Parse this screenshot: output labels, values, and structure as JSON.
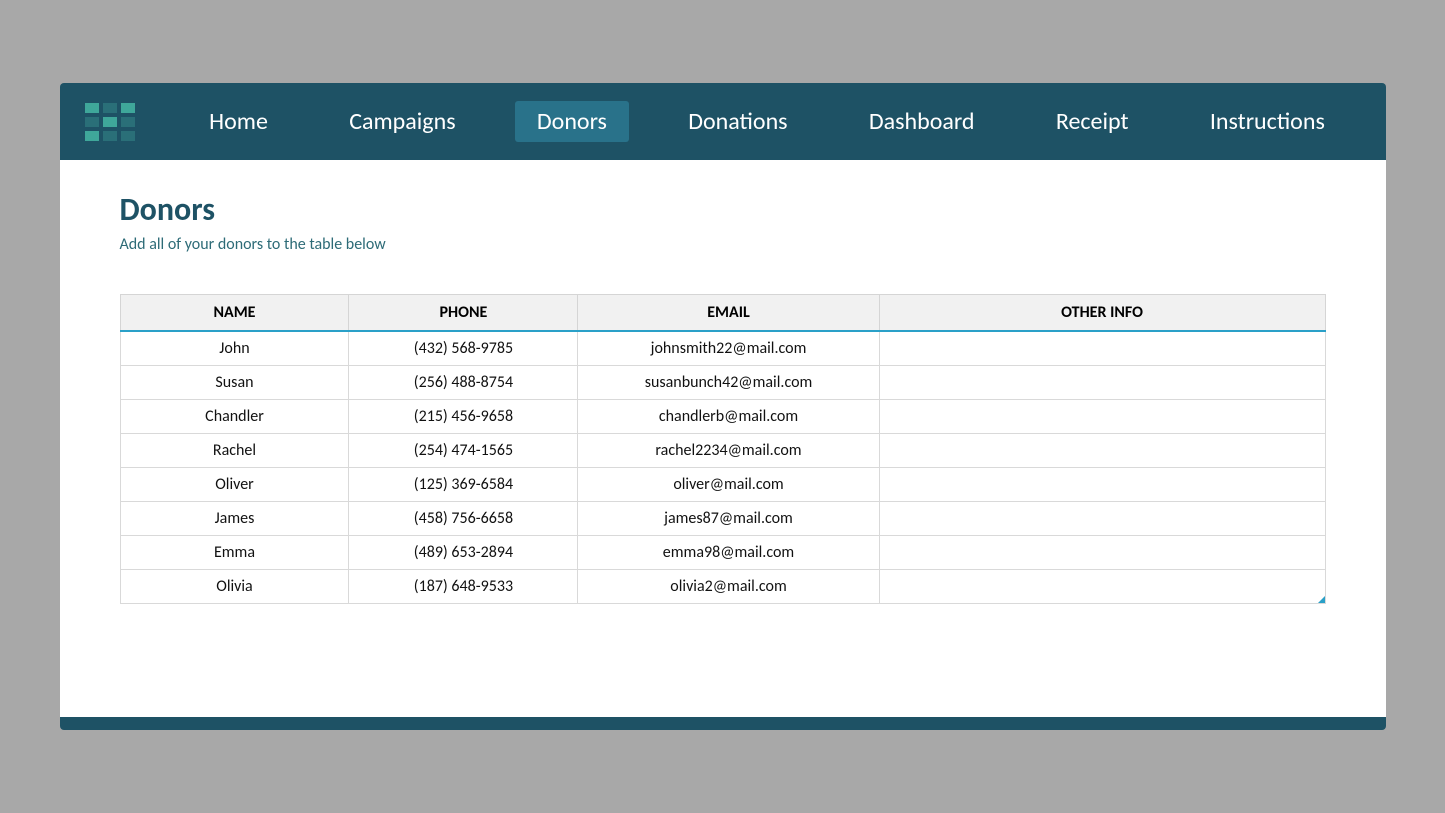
{
  "nav": {
    "items": [
      {
        "label": "Home",
        "id": "home",
        "active": false
      },
      {
        "label": "Campaigns",
        "id": "campaigns",
        "active": false
      },
      {
        "label": "Donors",
        "id": "donors",
        "active": true
      },
      {
        "label": "Donations",
        "id": "donations",
        "active": false
      },
      {
        "label": "Dashboard",
        "id": "dashboard",
        "active": false
      },
      {
        "label": "Receipt",
        "id": "receipt",
        "active": false
      },
      {
        "label": "Instructions",
        "id": "instructions",
        "active": false
      }
    ]
  },
  "page": {
    "title": "Donors",
    "subtitle": "Add all of your donors to the table below"
  },
  "table": {
    "columns": [
      "NAME",
      "PHONE",
      "EMAIL",
      "OTHER INFO"
    ],
    "rows": [
      {
        "name": "John",
        "phone": "(432) 568-9785",
        "email": "johnsmith22@mail.com",
        "other": ""
      },
      {
        "name": "Susan",
        "phone": "(256) 488-8754",
        "email": "susanbunch42@mail.com",
        "other": ""
      },
      {
        "name": "Chandler",
        "phone": "(215) 456-9658",
        "email": "chandlerb@mail.com",
        "other": ""
      },
      {
        "name": "Rachel",
        "phone": "(254) 474-1565",
        "email": "rachel2234@mail.com",
        "other": ""
      },
      {
        "name": "Oliver",
        "phone": "(125) 369-6584",
        "email": "oliver@mail.com",
        "other": ""
      },
      {
        "name": "James",
        "phone": "(458) 756-6658",
        "email": "james87@mail.com",
        "other": ""
      },
      {
        "name": "Emma",
        "phone": "(489) 653-2894",
        "email": "emma98@mail.com",
        "other": ""
      },
      {
        "name": "Olivia",
        "phone": "(187) 648-9533",
        "email": "olivia2@mail.com",
        "other": ""
      }
    ]
  }
}
